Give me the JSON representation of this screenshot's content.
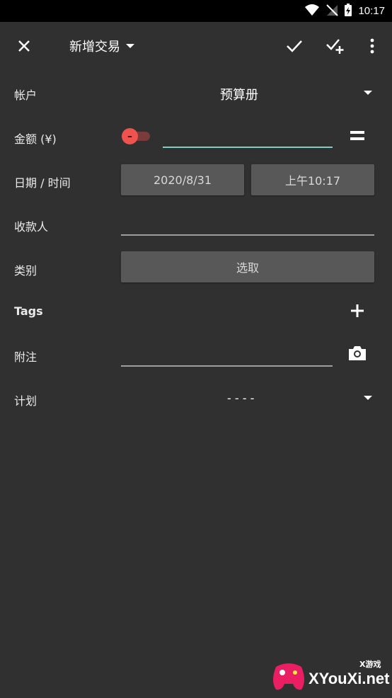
{
  "status_bar": {
    "time": "10:17"
  },
  "toolbar": {
    "title": "新增交易"
  },
  "form": {
    "account": {
      "label": "帐户",
      "value": "预算册"
    },
    "amount": {
      "label": "金额 (¥)",
      "sign": "–",
      "value": ""
    },
    "datetime": {
      "label": "日期 / 时间",
      "date": "2020/8/31",
      "time": "上午10:17"
    },
    "payee": {
      "label": "收款人",
      "value": ""
    },
    "category": {
      "label": "类别",
      "button": "选取"
    },
    "tags": {
      "label": "Tags"
    },
    "note": {
      "label": "附注",
      "value": ""
    },
    "plan": {
      "label": "计划",
      "value": "- - - -"
    }
  },
  "watermark": {
    "text": "XYouXi.net",
    "sub": "X游戏"
  },
  "colors": {
    "background": "#303030",
    "accent": "#7ecdc4",
    "toggle": "#ef5350"
  }
}
